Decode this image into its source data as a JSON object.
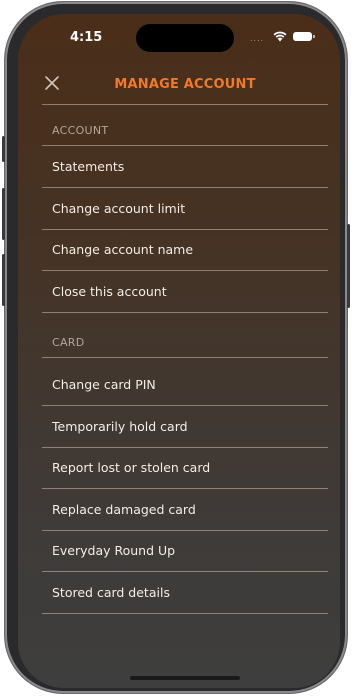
{
  "status_bar": {
    "time": "4:15",
    "signal": "....",
    "wifi_icon": "wifi-icon",
    "battery_icon": "battery-icon"
  },
  "header": {
    "close_icon": "close-icon",
    "title": "MANAGE ACCOUNT"
  },
  "colors": {
    "accent": "#f07a2a",
    "background_top": "#4a2e19",
    "background_bottom": "#3e3e3e",
    "row_text": "#f3ede6",
    "section_text": "#b3a598"
  },
  "sections": [
    {
      "title": "ACCOUNT",
      "items": [
        "Statements",
        "Change account limit",
        "Change account name",
        "Close this account"
      ]
    },
    {
      "title": "CARD",
      "items": [
        "Change card PIN",
        "Temporarily hold card",
        "Report lost or stolen card",
        "Replace damaged card",
        "Everyday Round Up",
        "Stored card details"
      ]
    }
  ]
}
